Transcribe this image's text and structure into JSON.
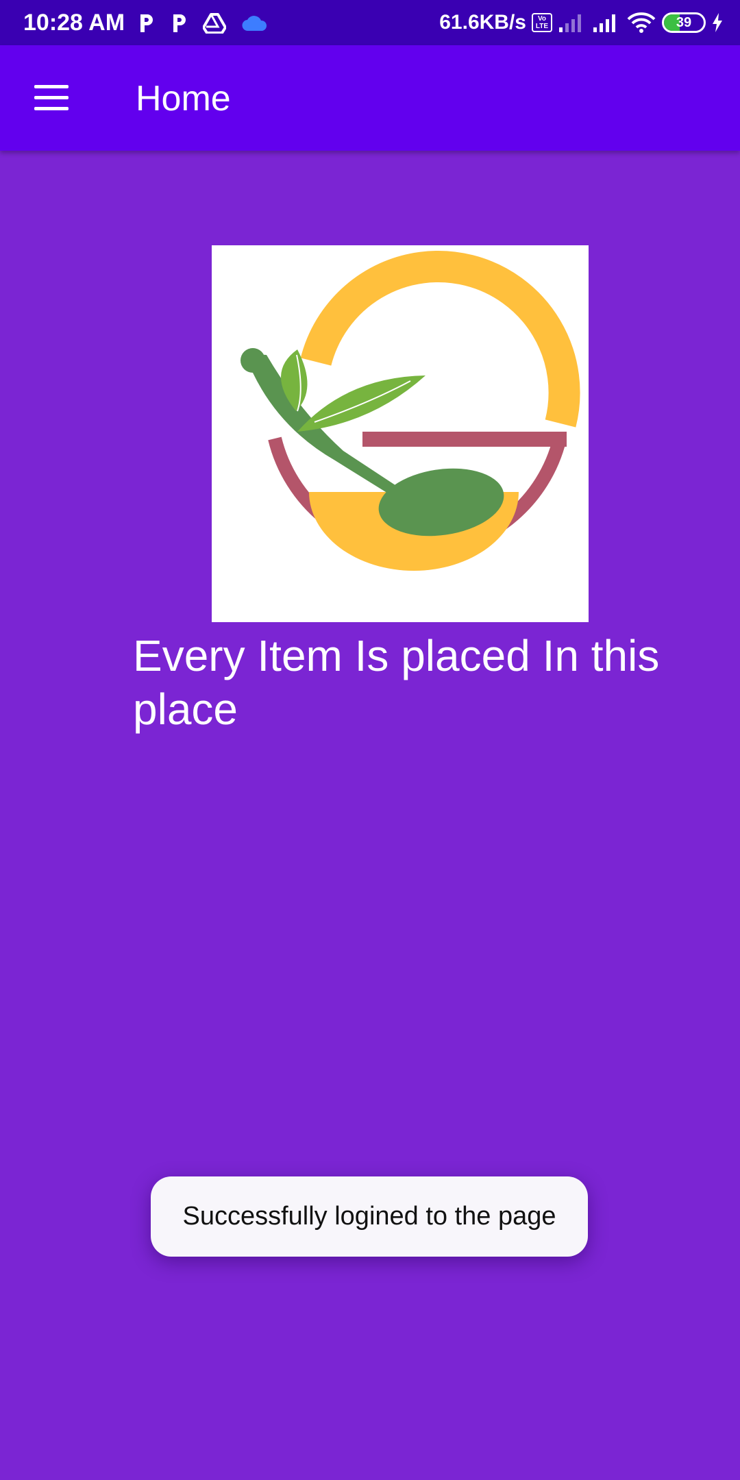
{
  "status_bar": {
    "time": "10:28 AM",
    "net_speed": "61.6KB/s",
    "volte_label": "Vo LTE",
    "battery_level": "39",
    "battery_fraction": 0.39,
    "notification_icons": [
      "p-app-icon",
      "p-app-icon",
      "drive-icon",
      "cloud-icon"
    ]
  },
  "app_bar": {
    "title": "Home",
    "menu_icon": "hamburger-menu-icon"
  },
  "main": {
    "logo_icon": "spoon-bowl-leaf-logo",
    "tagline": "Every Item Is placed In this place"
  },
  "toast": {
    "message": "Successfully logined to the page"
  },
  "colors": {
    "status_bar": "#3A00B2",
    "app_bar": "#6200EE",
    "background": "#7B25D3",
    "toast_bg": "#F8F6FB",
    "logo_yellow": "#FFC03D",
    "logo_red": "#B4556A",
    "logo_green": "#5A9450",
    "logo_leaf": "#77B43F"
  }
}
